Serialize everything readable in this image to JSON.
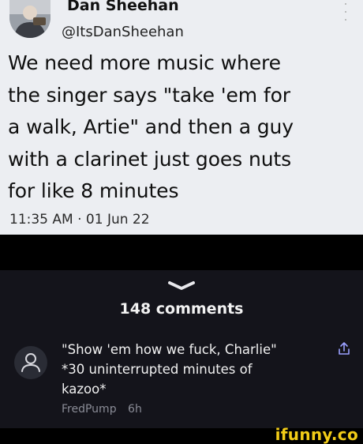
{
  "tweet": {
    "author_name": "Dan Sheehan",
    "author_handle": "@ItsDanSheehan",
    "text_lines": [
      "We need more music where",
      "the singer says \"take 'em for",
      "a walk, Artie\" and then a guy",
      "with a clarinet just goes nuts",
      "for like 8 minutes"
    ],
    "timestamp": "11:35 AM · 01 Jun 22"
  },
  "comments": {
    "count_label": "148 comments",
    "items": [
      {
        "text_lines": [
          "\"Show 'em how we fuck, Charlie\"",
          "*30 uninterrupted minutes of",
          "kazoo*"
        ],
        "username": "FredPump",
        "age": "6h"
      }
    ]
  },
  "watermark": "ifunny.co",
  "colors": {
    "tweet_bg": "#eceef2",
    "sheet_bg": "#14141b",
    "watermark": "#f2cc17"
  }
}
